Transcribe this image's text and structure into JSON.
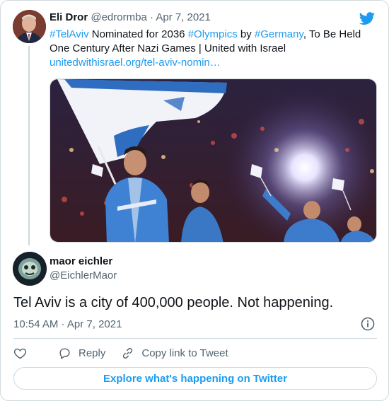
{
  "quoted_tweet": {
    "author_name": "Eli Dror",
    "author_handle": "@edrormba",
    "separator": "·",
    "date": "Apr 7, 2021",
    "text_parts": [
      {
        "text": "#TelAviv",
        "tag": true
      },
      {
        "text": " Nominated for 2036 ",
        "tag": false
      },
      {
        "text": "#Olympics",
        "tag": true
      },
      {
        "text": " by ",
        "tag": false
      },
      {
        "text": "#Germany",
        "tag": true
      },
      {
        "text": ", To Be Held One Century After Nazi Games | United with Israel",
        "tag": false
      }
    ],
    "link": "unitedwithisrael.org/tel-aviv-nomin…"
  },
  "reply": {
    "author_name": "maor eichler",
    "author_handle": "@EichlerMaor",
    "text": "Tel Aviv is a city of 400,000 people. Not happening.",
    "timestamp": "10:54 AM · Apr 7, 2021"
  },
  "actions": {
    "reply_label": "Reply",
    "copy_label": "Copy link to Tweet"
  },
  "explore_label": "Explore what's happening on Twitter",
  "colors": {
    "accent": "#1d9bf0",
    "text": "#0f1419",
    "secondary": "#536471",
    "border": "#cfd9de"
  }
}
